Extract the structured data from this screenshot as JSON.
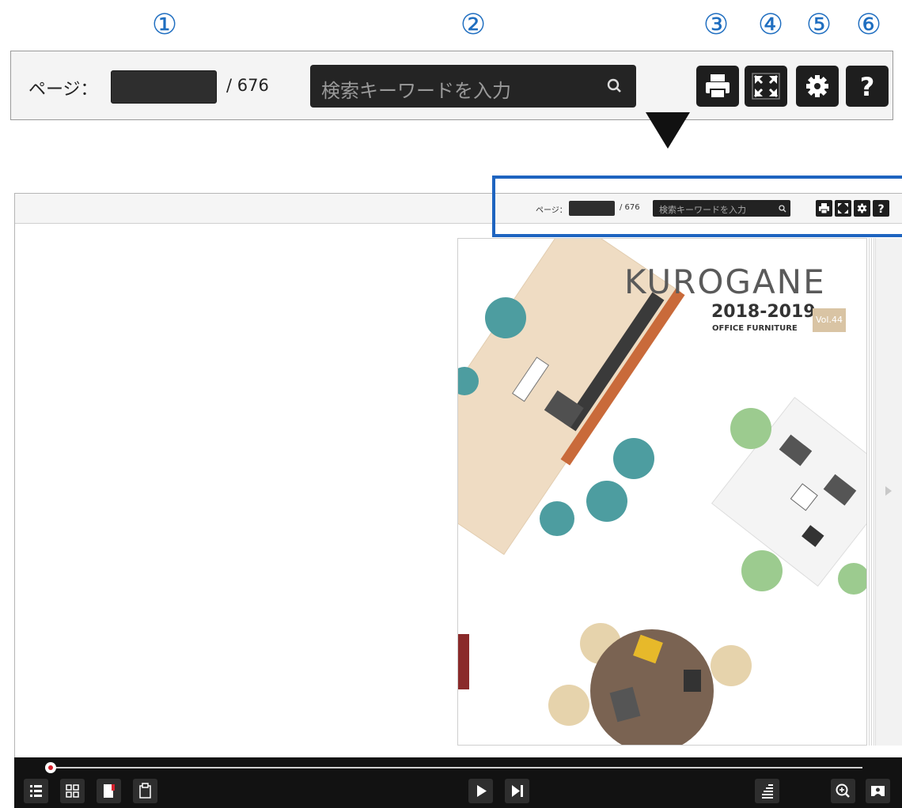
{
  "callouts": [
    "①",
    "②",
    "③",
    "④",
    "⑤",
    "⑥"
  ],
  "toolbar": {
    "page_label": "ページ：",
    "page_input": "",
    "page_total": "/ 676",
    "search_placeholder": "検索キーワードを入力",
    "buttons": [
      "print-icon",
      "fullscreen-icon",
      "gear-icon",
      "help-icon"
    ]
  },
  "viewer_toolbar": {
    "page_label": "ページ：",
    "page_total": "/ 676",
    "search_placeholder": "検索キーワードを入力"
  },
  "catalog": {
    "brand": "KUROGANE",
    "year": "2018-2019",
    "subtitle": "OFFICE FURNITURE",
    "volume": "Vol.44"
  },
  "bottom": {
    "progress": 0,
    "left_buttons": [
      "list-icon",
      "thumbnails-icon",
      "bookmark-icon",
      "paste-icon"
    ],
    "center_buttons": [
      "play-icon",
      "last-page-icon"
    ],
    "right_buttons": [
      "sort-icon",
      "zoom-in-icon",
      "page-view-icon"
    ]
  },
  "colors": {
    "accent": "#1e64c0",
    "bar": "#121212",
    "button": "#1e1e1e",
    "marker": "#d4202c"
  }
}
